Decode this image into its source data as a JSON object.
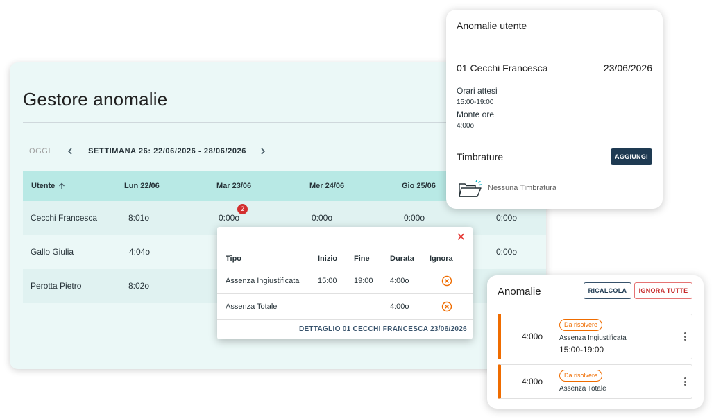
{
  "main": {
    "title": "Gestore anomalie",
    "today_label": "OGGI",
    "week_label": "SETTIMANA 26: 22/06/2026 - 28/06/2026",
    "columns": [
      "Utente",
      "Lun 22/06",
      "Mar 23/06",
      "Mer 24/06",
      "Gio 25/06"
    ],
    "rows": [
      {
        "name": "Cecchi Francesca",
        "mon": "8:01o",
        "tue": "0:00o",
        "wed": "0:00o",
        "thu": "0:00o",
        "extra": "0:00o",
        "badge": "2"
      },
      {
        "name": "Gallo Giulia",
        "mon": "4:04o",
        "extra": "0:00o"
      },
      {
        "name": "Perotta Pietro",
        "mon": "8:02o"
      }
    ]
  },
  "detail_popover": {
    "headers": {
      "type": "Tipo",
      "start": "Inizio",
      "end": "Fine",
      "duration": "Durata",
      "ignore": "Ignora"
    },
    "rows": [
      {
        "type": "Assenza Ingiustificata",
        "start": "15:00",
        "end": "19:00",
        "duration": "4:00o"
      },
      {
        "type": "Assenza Totale",
        "duration": "4:00o"
      }
    ],
    "footer": "DETTAGLIO 01 CECCHI FRANCESCA 23/06/2026"
  },
  "user_card": {
    "title": "Anomalie utente",
    "name": "01 Cecchi Francesca",
    "date": "23/06/2026",
    "expected_label": "Orari attesi",
    "expected_value": "15:00-19:00",
    "hours_label": "Monte ore",
    "hours_value": "4:00o",
    "stamps_title": "Timbrature",
    "add_button": "AGGIUNGI",
    "empty_text": "Nessuna Timbratura"
  },
  "anomalies": {
    "title": "Anomalie",
    "recalc_button": "RICALCOLA",
    "ignore_all_button": "IGNORA TUTTE",
    "items": [
      {
        "hours": "4:00o",
        "status": "Da risolvere",
        "type": "Assenza Ingiustificata",
        "time": "15:00-19:00"
      },
      {
        "hours": "4:00o",
        "status": "Da risolvere",
        "type": "Assenza Totale"
      }
    ]
  },
  "colors": {
    "accent": "#ef6c00",
    "header_teal": "#b8e9e5",
    "dark_button": "#1e3a52",
    "danger": "#d32f2f"
  }
}
